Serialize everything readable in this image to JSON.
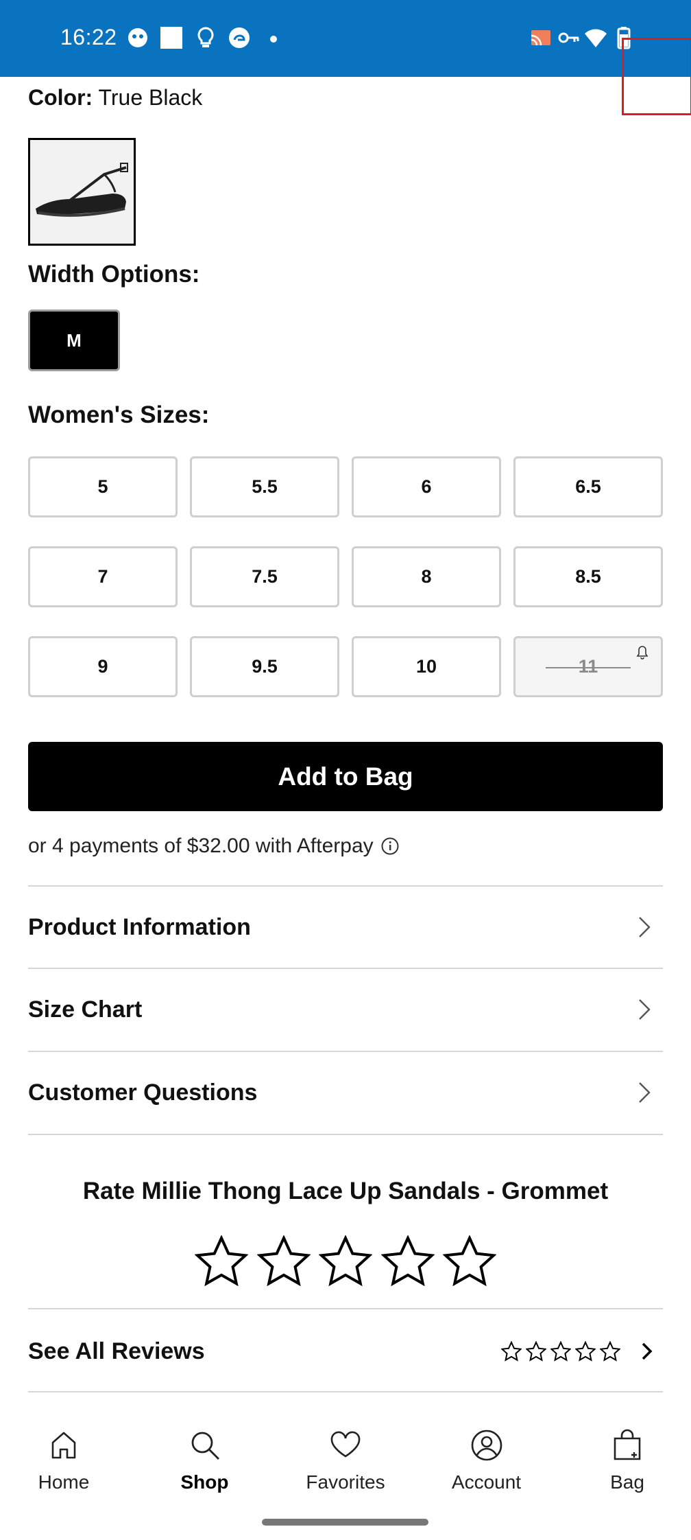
{
  "status_bar": {
    "time": "16:22",
    "icons_left": [
      "notification-app-icon",
      "square-app-icon",
      "lightbulb-icon",
      "edge-browser-icon",
      "more-dot-icon"
    ],
    "icons_right": [
      "cast-icon",
      "vpn-key-icon",
      "wifi-icon",
      "battery-icon"
    ],
    "background": "#0a73bf"
  },
  "product": {
    "color_label": "Color:",
    "color_value": "True Black",
    "swatch_icon": "sandal-thumbnail-image",
    "width_title": "Width Options:",
    "width_selected": "M",
    "sizes_title": "Women's Sizes:",
    "sizes": [
      {
        "label": "5",
        "available": true
      },
      {
        "label": "5.5",
        "available": true
      },
      {
        "label": "6",
        "available": true
      },
      {
        "label": "6.5",
        "available": true
      },
      {
        "label": "7",
        "available": true
      },
      {
        "label": "7.5",
        "available": true
      },
      {
        "label": "8",
        "available": true
      },
      {
        "label": "8.5",
        "available": true
      },
      {
        "label": "9",
        "available": true
      },
      {
        "label": "9.5",
        "available": true
      },
      {
        "label": "10",
        "available": true
      },
      {
        "label": "11",
        "available": false,
        "notify_icon": "bell-icon"
      }
    ]
  },
  "cta": {
    "add_to_bag": "Add to Bag",
    "afterpay_text": "or 4 payments of $32.00 with Afterpay"
  },
  "accordions": [
    {
      "label": "Product Information"
    },
    {
      "label": "Size Chart"
    },
    {
      "label": "Customer Questions"
    }
  ],
  "rating": {
    "title": "Rate Millie Thong Lace Up Sandals - Grommet",
    "stars_filled": 0,
    "stars_total": 5,
    "see_all_label": "See All Reviews"
  },
  "bottom_nav": [
    {
      "label": "Home",
      "icon": "home-icon",
      "active": false
    },
    {
      "label": "Shop",
      "icon": "search-icon",
      "active": true
    },
    {
      "label": "Favorites",
      "icon": "heart-icon",
      "active": false
    },
    {
      "label": "Account",
      "icon": "account-icon",
      "active": false
    },
    {
      "label": "Bag",
      "icon": "bag-icon",
      "active": false
    }
  ]
}
